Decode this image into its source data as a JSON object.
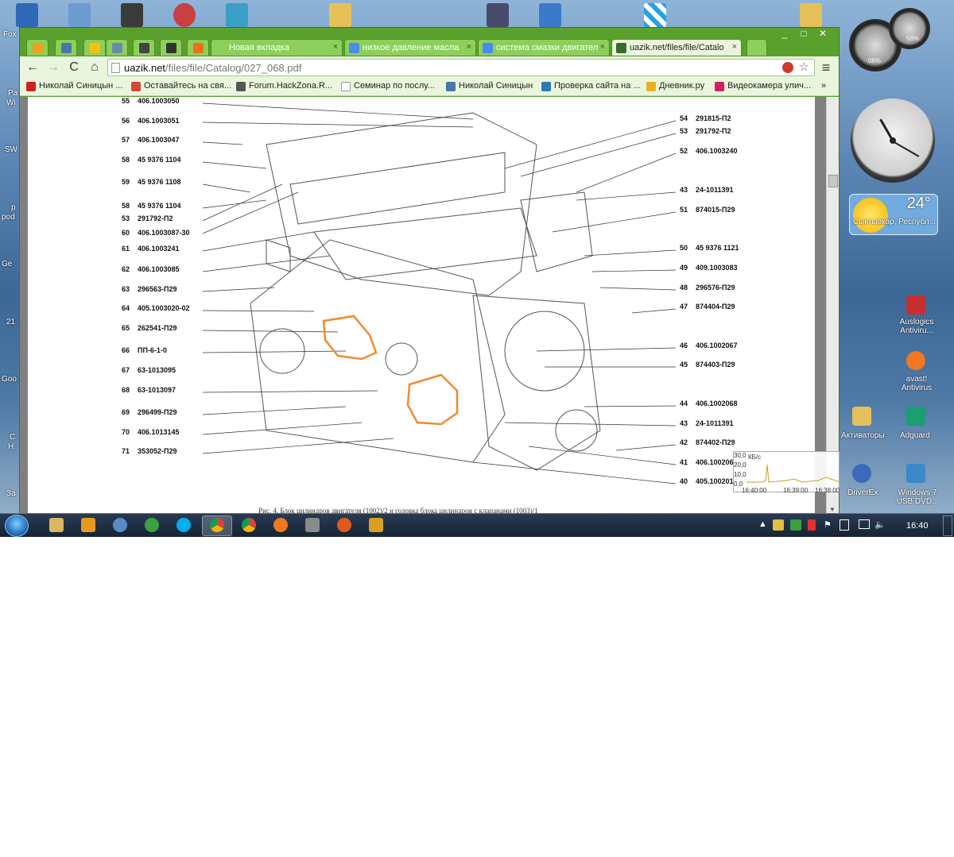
{
  "desktop": {
    "left_labels": [
      "Fox",
      "Pa",
      "Wi",
      "SW",
      "p",
      "pod",
      "Ge",
      "21",
      "Goo",
      "С",
      "Н",
      "За"
    ],
    "right_icons": [
      {
        "label": "Auslogics Antiviru...",
        "icon": "auslogics-icon"
      },
      {
        "label": "avast! Antivirus",
        "icon": "avast-icon"
      },
      {
        "label": "Активаторы",
        "icon": "folder-icon"
      },
      {
        "label": "Adguard",
        "icon": "adguard-icon"
      },
      {
        "label": "DriverEx",
        "icon": "driverex-icon"
      },
      {
        "label": "Windows 7 USB DVD...",
        "icon": "usb-dvd-icon"
      }
    ],
    "gadgets": {
      "meter": {
        "cpu": "06%",
        "ram": "56%"
      },
      "clock": {
        "time": "16:40"
      },
      "weather": {
        "temp": "24°",
        "city": "Сыктывкар, Республ..."
      },
      "network_monitor": {
        "unit": "КБ/с",
        "y_ticks": [
          "30,0",
          "20,0",
          "10,0",
          "0,0"
        ],
        "x_ticks": [
          "16:40:00",
          "16:39:00",
          "16:38:00"
        ]
      }
    }
  },
  "browser": {
    "tabs": [
      {
        "label": "Новая вкладка",
        "active": false
      },
      {
        "label": "низкое давление масла",
        "active": false
      },
      {
        "label": "сиcтема смазки двигател",
        "active": false
      },
      {
        "label": "uazik.net/files/file/Catalo",
        "active": true
      }
    ],
    "window_controls": {
      "minimize": "_",
      "maximize": "□",
      "close": "✕"
    },
    "nav": {
      "back": "←",
      "forward": "→",
      "reload": "C",
      "home": "⌂",
      "menu": "≡"
    },
    "url": {
      "host": "uazik.net",
      "path": "/files/file/Catalog/027_068.pdf"
    },
    "bookmarks": [
      "Николай Синицын ...",
      "Оставайтесь на свя...",
      "Forum.HackZona.R...",
      "Семинар по послу...",
      "Николай Синицын",
      "Проверка сайта на ...",
      "Дневник.ру",
      "Видеокамера улич..."
    ],
    "bookmarks_overflow": "»"
  },
  "pdf": {
    "left_parts": [
      {
        "n": "55",
        "code": "406.1003050"
      },
      {
        "n": "56",
        "code": "406.1003051"
      },
      {
        "n": "57",
        "code": "406.1003047"
      },
      {
        "n": "58",
        "code": "45 9376 1104"
      },
      {
        "n": "59",
        "code": "45 9376 1108"
      },
      {
        "n": "58",
        "code": "45 9376 1104"
      },
      {
        "n": "53",
        "code": "291792-П2"
      },
      {
        "n": "60",
        "code": "406.1003087-30"
      },
      {
        "n": "61",
        "code": "406.1003241"
      },
      {
        "n": "62",
        "code": "406.1003085"
      },
      {
        "n": "63",
        "code": "296563-П29"
      },
      {
        "n": "64",
        "code": "405.1003020-02"
      },
      {
        "n": "65",
        "code": "262541-П29"
      },
      {
        "n": "66",
        "code": "ПП-6-1-0"
      },
      {
        "n": "67",
        "code": "63-1013095"
      },
      {
        "n": "68",
        "code": "63-1013097"
      },
      {
        "n": "69",
        "code": "296499-П29"
      },
      {
        "n": "70",
        "code": "406.1013145"
      },
      {
        "n": "71",
        "code": "353052-П29"
      }
    ],
    "right_parts": [
      {
        "n": "54",
        "code": "291815-П2"
      },
      {
        "n": "53",
        "code": "291792-П2"
      },
      {
        "n": "52",
        "code": "406.1003240"
      },
      {
        "n": "43",
        "code": "24-1011391"
      },
      {
        "n": "51",
        "code": "874015-П29"
      },
      {
        "n": "50",
        "code": "45 9376 1121"
      },
      {
        "n": "49",
        "code": "409.1003083"
      },
      {
        "n": "48",
        "code": "296576-П29"
      },
      {
        "n": "47",
        "code": "874404-П29"
      },
      {
        "n": "46",
        "code": "406.1002067"
      },
      {
        "n": "45",
        "code": "874403-П29"
      },
      {
        "n": "44",
        "code": "406.1002068"
      },
      {
        "n": "43",
        "code": "24-1011391"
      },
      {
        "n": "42",
        "code": "874402-П29"
      },
      {
        "n": "41",
        "code": "406.1002062-01"
      },
      {
        "n": "40",
        "code": "405.1002010-10"
      }
    ],
    "caption": "Рис. 4. Блок цилиндров двигателя (1002)/2 и головка блока цилиндров с клапанами (1003)/1",
    "highlight_color": "#f08a30"
  },
  "taskbar": {
    "apps": [
      "explorer-icon",
      "media-player-icon",
      "chrome-icon",
      "utorrent-icon",
      "skype-icon",
      "chrome-active-icon",
      "ie-icon",
      "avast-icon",
      "tools-icon",
      "firefox-icon",
      "misc-icon"
    ],
    "tray_arrow": "▲",
    "time": "16:40"
  }
}
